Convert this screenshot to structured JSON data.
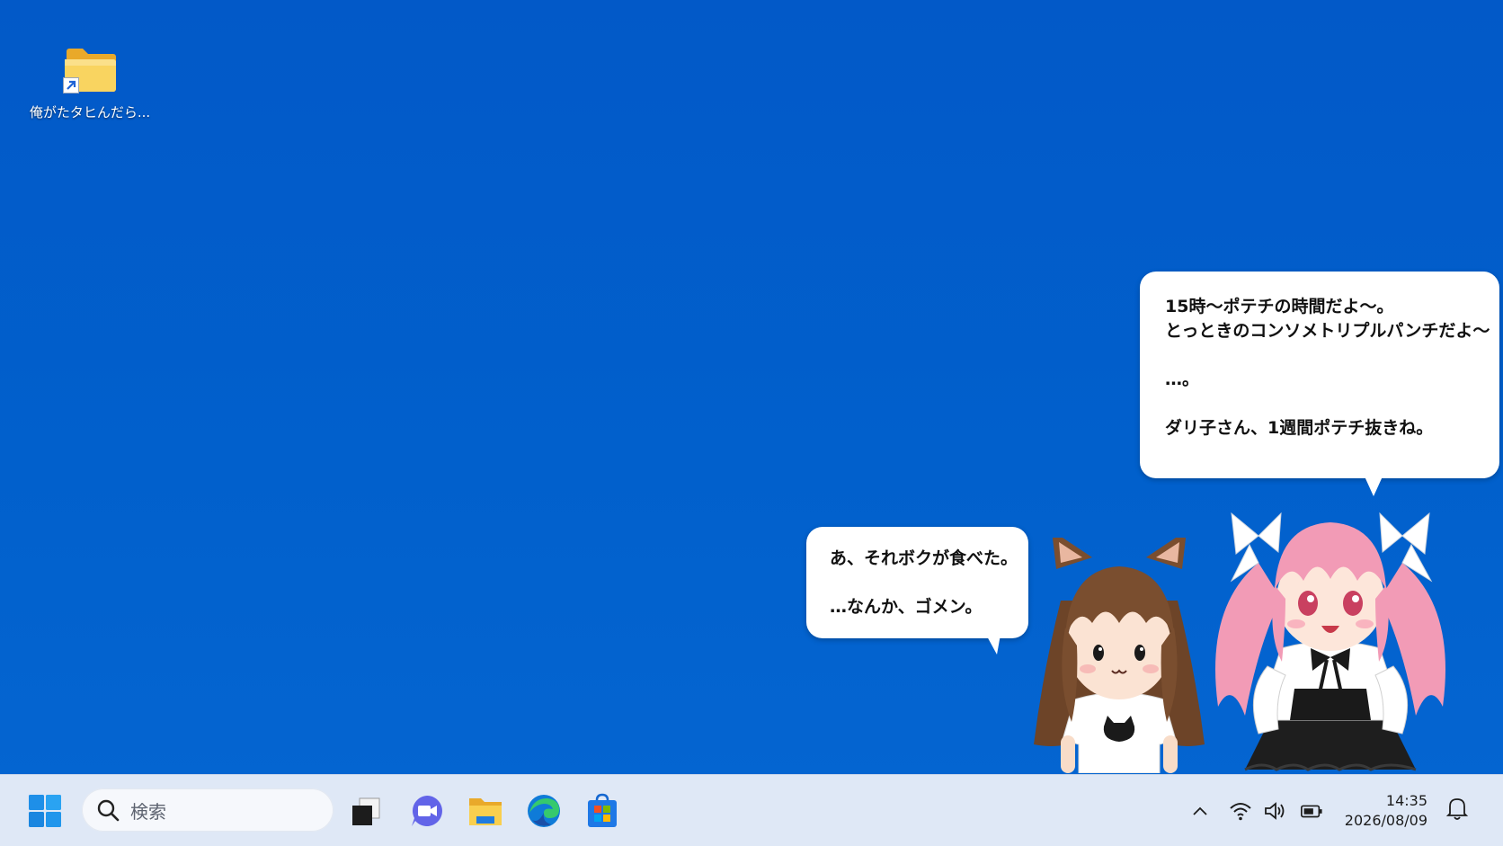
{
  "desktop": {
    "icons": [
      {
        "label": "俺がたタヒんだら..."
      }
    ]
  },
  "speech": {
    "right_bubble": {
      "lines": [
        "15時〜ポテチの時間だよ〜。",
        "とっときのコンソメトリプルパンチだよ〜",
        "",
        "…。",
        "",
        "ダリ子さん、1週間ポテチ抜きね。"
      ]
    },
    "left_bubble": {
      "lines": [
        "あ、それボクが食べた。",
        "",
        "…なんか、ゴメン。"
      ]
    }
  },
  "taskbar": {
    "search_placeholder": "検索",
    "pinned": [
      "start-icon",
      "task-view-icon",
      "meet-icon",
      "file-explorer-icon",
      "edge-icon",
      "store-icon"
    ],
    "tray": [
      "chevron-up-icon",
      "wifi-icon",
      "volume-icon",
      "battery-icon"
    ],
    "clock": {
      "time": "14:35",
      "date": "2026/08/09"
    }
  },
  "colors": {
    "desktop_bg": "#0160cc",
    "taskbar_bg": "#dfe8f6",
    "folder_yellow": "#f7c948",
    "pink_hair": "#f29bb6",
    "brown_hair": "#7a4e2f"
  }
}
